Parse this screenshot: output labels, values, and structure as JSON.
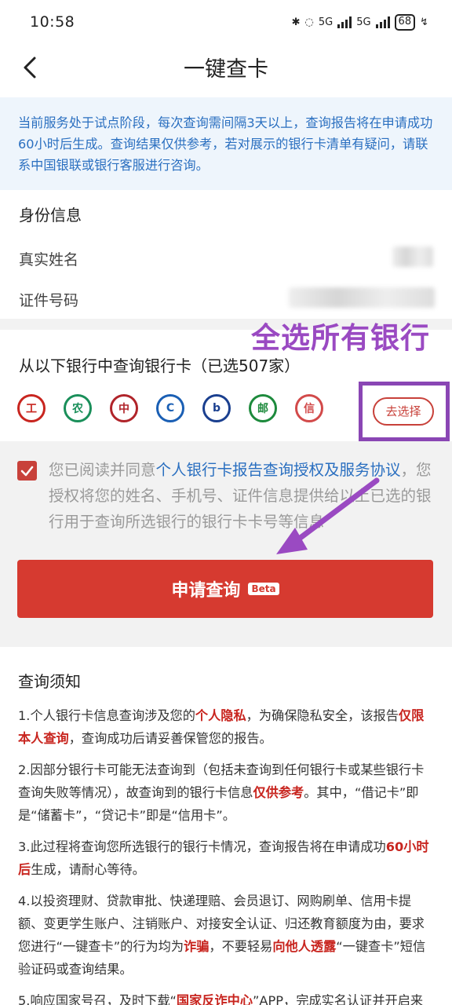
{
  "status_bar": {
    "time": "10:58",
    "battery": "68",
    "net1": "5G",
    "net2": "5G"
  },
  "header": {
    "title": "一键查卡"
  },
  "notice": {
    "text": "当前服务处于试点阶段，每次查询需间隔3天以上，查询报告将在申请成功60小时后生成。查询结果仅供参考，若对展示的银行卡清单有疑问，请联系中国银联或银行客服进行咨询。"
  },
  "identity": {
    "heading": "身份信息",
    "name_label": "真实姓名",
    "id_label": "证件号码"
  },
  "banks": {
    "heading": "从以下银行中查询银行卡（已选507家）",
    "choose_label": "去选择",
    "icons": [
      {
        "name": "icbc-logo-icon",
        "glyph": "工",
        "color": "#c8251f"
      },
      {
        "name": "abc-logo-icon",
        "glyph": "农",
        "color": "#1a8f5a"
      },
      {
        "name": "boc-logo-icon",
        "glyph": "中",
        "color": "#b0242a"
      },
      {
        "name": "ccb-logo-icon",
        "glyph": "C",
        "color": "#1a5fb4"
      },
      {
        "name": "bocom-logo-icon",
        "glyph": "b",
        "color": "#1a3f8f"
      },
      {
        "name": "psbc-logo-icon",
        "glyph": "邮",
        "color": "#1d8a3c"
      },
      {
        "name": "citic-logo-icon",
        "glyph": "信",
        "color": "#d24a4a"
      }
    ]
  },
  "annotation": {
    "text": "全选所有银行"
  },
  "agreement": {
    "prefix": "您已阅读并同意",
    "link": "个人银行卡报告查询授权及服务协议",
    "suffix": "，您授权将您的姓名、手机号、证件信息提供给以上已选的银行用于查询所选银行的银行卡卡号等信息"
  },
  "apply": {
    "label": "申请查询",
    "badge": "Beta"
  },
  "notes": {
    "heading": "查询须知",
    "p1": {
      "a": "1.个人银行卡信息查询涉及您的",
      "b": "个人隐私",
      "c": "，为确保隐私安全，该报告",
      "d": "仅限本人查询",
      "e": "，查询成功后请妥善保管您的报告。"
    },
    "p2": {
      "a": "2.因部分银行卡可能无法查询到（包括未查询到任何银行卡或某些银行卡查询失败等情况），故查询到的银行卡信息",
      "b": "仅供参考",
      "c": "。其中，“借记卡”即是“储蓄卡”，“贷记卡”即是“信用卡”。"
    },
    "p3": {
      "a": "3.此过程将查询您所选银行的银行卡情况，查询报告将在申请成功",
      "b": "60小时后",
      "c": "生成，请耐心等待。"
    },
    "p4": {
      "a": "4.以投资理财、贷款审批、快递理赔、会员退订、网购刷单、信用卡提额、变更学生账户、注销账户、对接安全认证、归还教育额度为由，要求您进行“一键查卡”的行为均为",
      "b": "诈骗",
      "c": "，不要轻易",
      "d": "向他人透露",
      "e": "“一键查卡”短信验证码或查询结果。"
    },
    "p5": {
      "a": "5.响应国家号召，及时下载“",
      "b": "国家反诈中心",
      "c": "”APP，完成实名认证并开启来电预警功能，全国携手，全力防范电信诈骗。"
    }
  }
}
